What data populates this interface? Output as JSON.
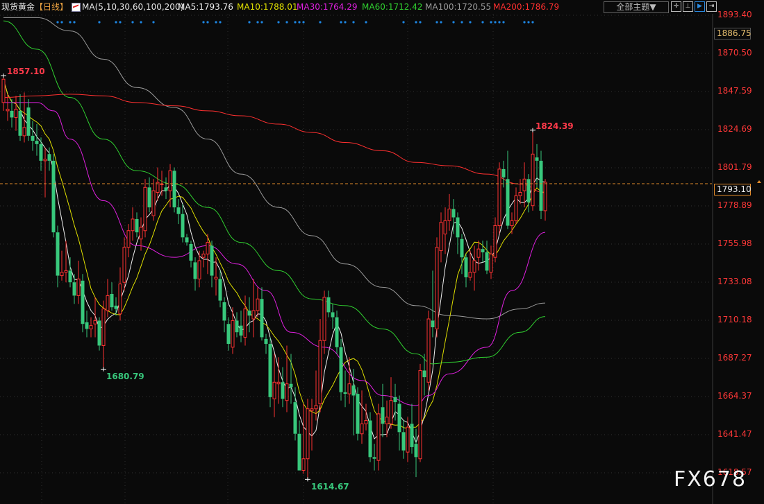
{
  "header": {
    "instrument": "现货黄金",
    "period": "【日线】",
    "ma_params": "MA(5,10,30,60,100,200)",
    "ma_values": [
      {
        "label": "MA5:1793.76",
        "color": "#f0f0f0"
      },
      {
        "label": "MA10:1788.01",
        "color": "#e0e000"
      },
      {
        "label": "MA30:1764.29",
        "color": "#e020e0"
      },
      {
        "label": "MA60:1712.42",
        "color": "#30d030"
      },
      {
        "label": "MA100:1720.55",
        "color": "#9a9a9a"
      },
      {
        "label": "MA200:1786.79",
        "color": "#ff3030"
      }
    ],
    "theme_button": "全部主题▼",
    "tool_buttons": [
      "crosshair-icon",
      "fit-range-icon",
      "play-icon",
      "exit-icon"
    ]
  },
  "watermark": "FX678",
  "chart_data": {
    "type": "candlestick",
    "title": "",
    "up_color": "#ff3232",
    "down_color": "#38c87c",
    "ylim": [
      1612,
      1899
    ],
    "y_ticks": [
      "1893.40",
      "1870.50",
      "1847.59",
      "1824.69",
      "1801.79",
      "1778.89",
      "1755.98",
      "1733.08",
      "1710.18",
      "1687.27",
      "1664.37",
      "1641.47",
      "1618.57"
    ],
    "current_price": "1793.10",
    "upper_marker_price": "1886.75",
    "annotations": [
      {
        "bar": 0,
        "label": "1857.10",
        "kind": "high"
      },
      {
        "bar": 127,
        "label": "1824.39",
        "kind": "high"
      },
      {
        "bar": 24,
        "label": "1680.79",
        "kind": "low"
      },
      {
        "bar": 73,
        "label": "1614.67",
        "kind": "low"
      }
    ],
    "ohlc": [
      [
        1841,
        1857.1,
        1836,
        1855
      ],
      [
        1836,
        1846,
        1830,
        1837
      ],
      [
        1836,
        1843,
        1826,
        1832
      ],
      [
        1832,
        1845,
        1824,
        1837
      ],
      [
        1836,
        1846,
        1818,
        1821
      ],
      [
        1821,
        1847,
        1817,
        1826
      ],
      [
        1838,
        1843,
        1818,
        1821
      ],
      [
        1821,
        1830,
        1812,
        1818
      ],
      [
        1818,
        1828,
        1809,
        1816
      ],
      [
        1816,
        1820,
        1800,
        1806
      ],
      [
        1806,
        1814,
        1784,
        1807
      ],
      [
        1810,
        1814,
        1800,
        1806
      ],
      [
        1806,
        1810,
        1760,
        1763
      ],
      [
        1763,
        1767,
        1730,
        1737
      ],
      [
        1737,
        1752,
        1734,
        1739
      ],
      [
        1739,
        1758,
        1733,
        1740
      ],
      [
        1740,
        1748,
        1730,
        1733
      ],
      [
        1733,
        1738,
        1720,
        1725
      ],
      [
        1725,
        1746,
        1720,
        1735
      ],
      [
        1734,
        1738,
        1703,
        1708
      ],
      [
        1709,
        1716,
        1700,
        1705
      ],
      [
        1705,
        1712,
        1700,
        1707
      ],
      [
        1708,
        1724,
        1700,
        1710
      ],
      [
        1710,
        1712,
        1692,
        1695
      ],
      [
        1695,
        1722,
        1680.79,
        1717
      ],
      [
        1716,
        1735,
        1712,
        1725
      ],
      [
        1726,
        1733,
        1716,
        1718
      ],
      [
        1719,
        1724,
        1713,
        1717
      ],
      [
        1714,
        1742,
        1710,
        1732
      ],
      [
        1733,
        1760,
        1728,
        1754
      ],
      [
        1754,
        1768,
        1748,
        1764
      ],
      [
        1764,
        1778,
        1758,
        1771
      ],
      [
        1771,
        1775,
        1760,
        1763
      ],
      [
        1759,
        1772,
        1752,
        1766
      ],
      [
        1764,
        1795,
        1760,
        1790
      ],
      [
        1790,
        1796,
        1775,
        1778
      ],
      [
        1773,
        1795,
        1770,
        1788
      ],
      [
        1787,
        1802,
        1782,
        1793
      ],
      [
        1792,
        1800,
        1785,
        1792
      ],
      [
        1790,
        1796,
        1783,
        1788
      ],
      [
        1788,
        1804,
        1778,
        1800
      ],
      [
        1800,
        1802,
        1775,
        1778
      ],
      [
        1778,
        1783,
        1768,
        1774
      ],
      [
        1774,
        1780,
        1757,
        1760
      ],
      [
        1760,
        1762,
        1755,
        1757
      ],
      [
        1756,
        1758,
        1742,
        1746
      ],
      [
        1745,
        1748,
        1728,
        1735
      ],
      [
        1735,
        1752,
        1730,
        1746
      ],
      [
        1748,
        1752,
        1742,
        1750
      ],
      [
        1750,
        1762,
        1738,
        1757
      ],
      [
        1755,
        1758,
        1730,
        1737
      ],
      [
        1735,
        1748,
        1725,
        1736
      ],
      [
        1735,
        1740,
        1718,
        1722
      ],
      [
        1721,
        1724,
        1703,
        1710
      ],
      [
        1708,
        1712,
        1692,
        1696
      ],
      [
        1694,
        1718,
        1690,
        1710
      ],
      [
        1710,
        1715,
        1700,
        1703
      ],
      [
        1707,
        1716,
        1697,
        1701
      ],
      [
        1700,
        1725,
        1695,
        1717
      ],
      [
        1716,
        1724,
        1703,
        1713
      ],
      [
        1711,
        1735,
        1700,
        1716
      ],
      [
        1716,
        1730,
        1712,
        1723
      ],
      [
        1723,
        1730,
        1698,
        1700
      ],
      [
        1699,
        1702,
        1690,
        1696
      ],
      [
        1696,
        1700,
        1658,
        1664
      ],
      [
        1663,
        1690,
        1652,
        1673
      ],
      [
        1672,
        1688,
        1660,
        1673
      ],
      [
        1673,
        1682,
        1658,
        1663
      ],
      [
        1662,
        1695,
        1655,
        1672
      ],
      [
        1672,
        1690,
        1660,
        1670
      ],
      [
        1661,
        1670,
        1638,
        1642
      ],
      [
        1642,
        1650,
        1620,
        1620
      ],
      [
        1620,
        1660,
        1618,
        1627
      ],
      [
        1627,
        1663,
        1614.67,
        1657
      ],
      [
        1656,
        1663,
        1632,
        1657
      ],
      [
        1657,
        1680,
        1650,
        1659
      ],
      [
        1660,
        1711,
        1655,
        1698
      ],
      [
        1698,
        1728,
        1690,
        1724
      ],
      [
        1724,
        1728,
        1712,
        1715
      ],
      [
        1715,
        1720,
        1705,
        1712
      ],
      [
        1712,
        1716,
        1690,
        1694
      ],
      [
        1694,
        1699,
        1662,
        1667
      ],
      [
        1667,
        1680,
        1658,
        1666
      ],
      [
        1666,
        1688,
        1660,
        1672
      ],
      [
        1671,
        1681,
        1641,
        1665
      ],
      [
        1666,
        1670,
        1638,
        1642
      ],
      [
        1642,
        1668,
        1636,
        1648
      ],
      [
        1648,
        1660,
        1644,
        1650
      ],
      [
        1650,
        1655,
        1625,
        1628
      ],
      [
        1628,
        1636,
        1620,
        1627
      ],
      [
        1626,
        1660,
        1620,
        1654
      ],
      [
        1658,
        1672,
        1640,
        1648
      ],
      [
        1648,
        1662,
        1640,
        1652
      ],
      [
        1648,
        1676,
        1645,
        1662
      ],
      [
        1664,
        1672,
        1650,
        1661
      ],
      [
        1660,
        1665,
        1632,
        1643
      ],
      [
        1643,
        1650,
        1627,
        1632
      ],
      [
        1631,
        1652,
        1625,
        1646
      ],
      [
        1648,
        1660,
        1630,
        1634
      ],
      [
        1636,
        1645,
        1616,
        1628
      ],
      [
        1627,
        1684,
        1625,
        1680
      ],
      [
        1680,
        1690,
        1665,
        1676
      ],
      [
        1673,
        1716,
        1668,
        1711
      ],
      [
        1710,
        1740,
        1700,
        1706
      ],
      [
        1705,
        1760,
        1700,
        1754
      ],
      [
        1752,
        1775,
        1745,
        1769
      ],
      [
        1762,
        1778,
        1750,
        1770
      ],
      [
        1770,
        1786,
        1764,
        1777
      ],
      [
        1777,
        1783,
        1762,
        1772
      ],
      [
        1772,
        1775,
        1750,
        1760
      ],
      [
        1759,
        1762,
        1738,
        1748
      ],
      [
        1748,
        1750,
        1730,
        1736
      ],
      [
        1736,
        1752,
        1734,
        1739
      ],
      [
        1739,
        1755,
        1728,
        1746
      ],
      [
        1748,
        1758,
        1740,
        1753
      ],
      [
        1753,
        1758,
        1745,
        1751
      ],
      [
        1751,
        1758,
        1738,
        1740
      ],
      [
        1739,
        1755,
        1735,
        1750
      ],
      [
        1748,
        1772,
        1745,
        1767
      ],
      [
        1767,
        1805,
        1762,
        1801
      ],
      [
        1801,
        1806,
        1790,
        1796
      ],
      [
        1795,
        1812,
        1765,
        1767
      ],
      [
        1767,
        1775,
        1762,
        1770
      ],
      [
        1770,
        1790,
        1768,
        1785
      ],
      [
        1785,
        1795,
        1780,
        1787
      ],
      [
        1788,
        1805,
        1778,
        1795
      ],
      [
        1795,
        1798,
        1775,
        1781
      ],
      [
        1779,
        1824.39,
        1776,
        1810
      ],
      [
        1808,
        1816,
        1790,
        1806
      ],
      [
        1806,
        1812,
        1771,
        1776
      ],
      [
        1776,
        1795,
        1770,
        1793.1
      ]
    ],
    "moving_averages": [
      {
        "name": "MA5",
        "period": 5,
        "color": "#f0f0f0"
      },
      {
        "name": "MA10",
        "period": 10,
        "color": "#e0e000"
      },
      {
        "name": "MA30",
        "color": "#e020e0",
        "points_bar_value": [
          [
            0,
            1841
          ],
          [
            8,
            1841
          ],
          [
            12,
            1836
          ],
          [
            16,
            1819
          ],
          [
            24,
            1782
          ],
          [
            32,
            1755
          ],
          [
            41,
            1748
          ],
          [
            49,
            1755
          ],
          [
            56,
            1744
          ],
          [
            63,
            1728
          ],
          [
            69,
            1703
          ],
          [
            77,
            1694
          ],
          [
            86,
            1674
          ],
          [
            91,
            1665
          ],
          [
            99,
            1659
          ],
          [
            102,
            1665
          ],
          [
            107,
            1678
          ],
          [
            116,
            1694
          ],
          [
            122,
            1728
          ],
          [
            130,
            1763
          ]
        ]
      },
      {
        "name": "MA60",
        "color": "#30d030",
        "points_bar_value": [
          [
            0,
            1890
          ],
          [
            8,
            1873
          ],
          [
            16,
            1844
          ],
          [
            24,
            1819
          ],
          [
            32,
            1800
          ],
          [
            41,
            1792
          ],
          [
            49,
            1778
          ],
          [
            57,
            1757
          ],
          [
            66,
            1740
          ],
          [
            74,
            1723
          ],
          [
            82,
            1719
          ],
          [
            91,
            1705
          ],
          [
            99,
            1690
          ],
          [
            103,
            1684
          ],
          [
            107,
            1685
          ],
          [
            116,
            1688
          ],
          [
            124,
            1703
          ],
          [
            130,
            1712.42
          ]
        ]
      },
      {
        "name": "MA100",
        "color": "#9a9a9a",
        "points_bar_value": [
          [
            0,
            1892
          ],
          [
            8,
            1892
          ],
          [
            16,
            1884
          ],
          [
            24,
            1867
          ],
          [
            32,
            1850
          ],
          [
            41,
            1838
          ],
          [
            49,
            1819
          ],
          [
            57,
            1798
          ],
          [
            66,
            1778
          ],
          [
            74,
            1761
          ],
          [
            82,
            1744
          ],
          [
            91,
            1730
          ],
          [
            99,
            1719
          ],
          [
            107,
            1713
          ],
          [
            116,
            1711
          ],
          [
            124,
            1717
          ],
          [
            130,
            1720.55
          ]
        ]
      },
      {
        "name": "MA200",
        "color": "#ff3030",
        "points_bar_value": [
          [
            0,
            1844
          ],
          [
            8,
            1845
          ],
          [
            16,
            1846
          ],
          [
            24,
            1845
          ],
          [
            32,
            1841
          ],
          [
            41,
            1839
          ],
          [
            49,
            1836
          ],
          [
            57,
            1833
          ],
          [
            66,
            1828
          ],
          [
            74,
            1823
          ],
          [
            82,
            1817
          ],
          [
            91,
            1812
          ],
          [
            99,
            1805
          ],
          [
            107,
            1803
          ],
          [
            116,
            1798
          ],
          [
            124,
            1792
          ],
          [
            130,
            1786.79
          ]
        ]
      }
    ],
    "event_markers_bars": [
      13,
      14,
      16,
      17,
      23,
      27,
      28,
      31,
      33,
      36,
      48,
      49,
      51,
      52,
      59,
      61,
      62,
      66,
      68,
      70,
      71,
      72,
      76,
      81,
      82,
      84,
      87,
      96,
      99,
      100,
      104,
      105,
      108,
      110,
      112,
      115,
      117,
      118,
      119,
      120,
      125,
      126,
      127
    ]
  }
}
